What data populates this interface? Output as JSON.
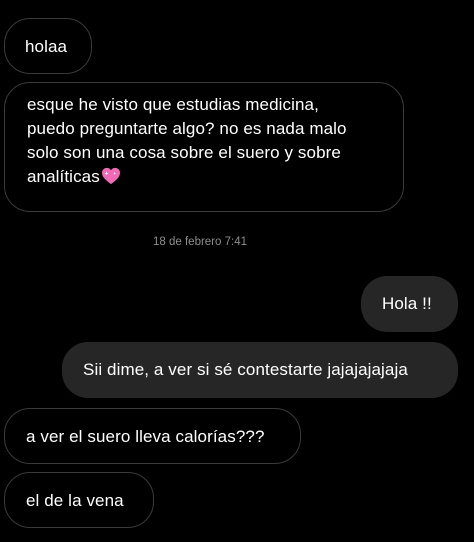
{
  "conversation": {
    "messages": [
      {
        "sender": "other",
        "lines": [
          "holaa"
        ]
      },
      {
        "sender": "other",
        "lines": [
          "esque he visto que estudias medicina,",
          "puedo preguntarte algo? no es nada malo",
          "solo son una cosa sobre el suero y sobre",
          "analíticas"
        ],
        "trailing_emoji": "sparkling-heart"
      },
      {
        "sender": "me",
        "lines": [
          "Hola !!"
        ]
      },
      {
        "sender": "me",
        "lines": [
          "Sii dime, a ver si sé contestarte jajajajajaja"
        ]
      },
      {
        "sender": "other",
        "lines": [
          "a ver el suero lleva calorías???"
        ]
      },
      {
        "sender": "other",
        "lines": [
          "el de la vena"
        ]
      }
    ],
    "timestamp": "18 de febrero 7:41"
  },
  "colors": {
    "background": "#000000",
    "incoming_border": "#3a3a3a",
    "outgoing_bubble": "#262626",
    "text": "#ffffff",
    "timestamp_text": "#8e8e8e",
    "heart": "#f06ab5"
  }
}
